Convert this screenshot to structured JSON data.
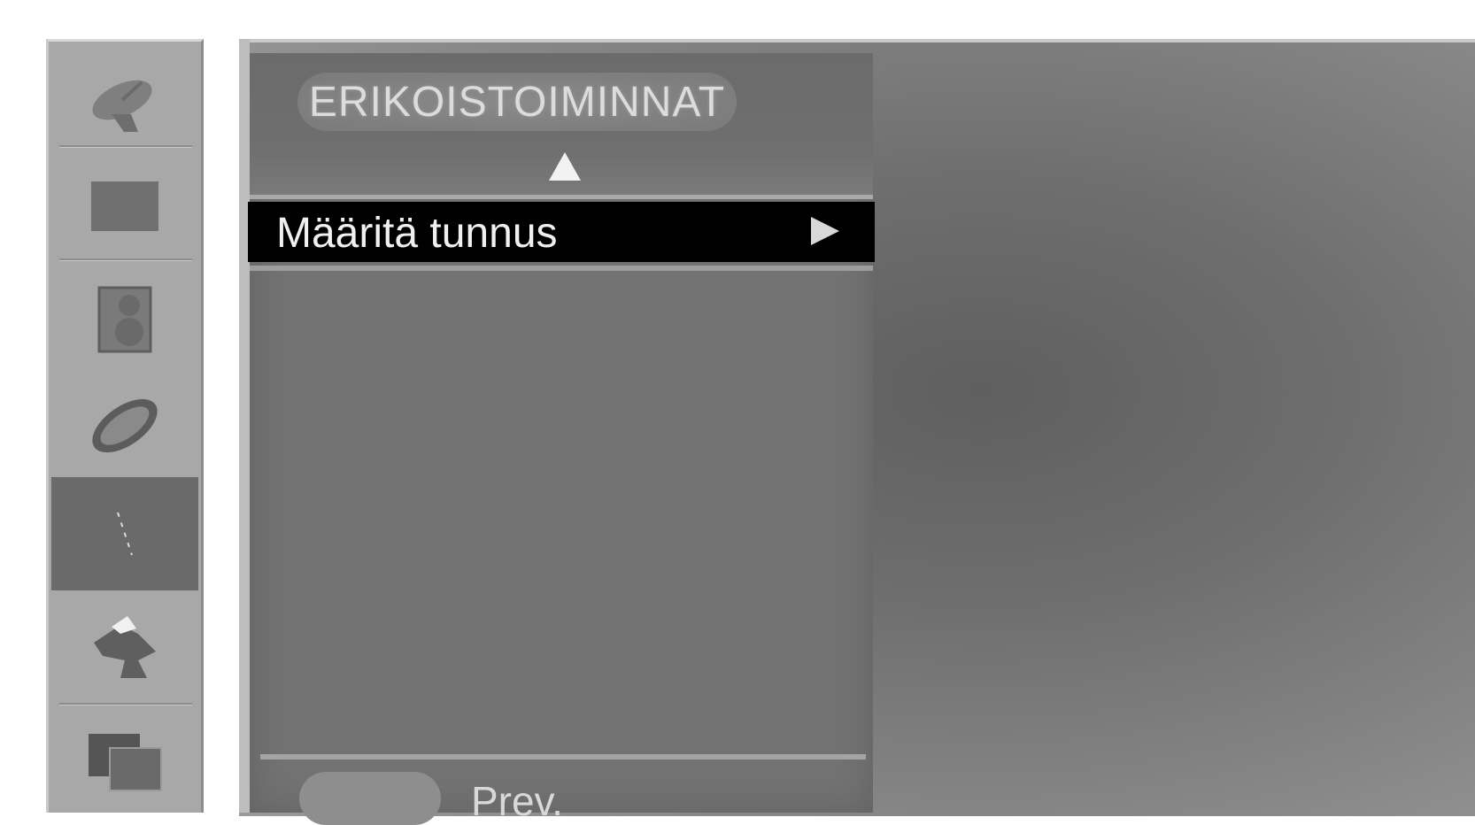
{
  "menu": {
    "title": "ERIKOISTOIMINNAT",
    "selected_item": "Määritä tunnus",
    "footer_label": "Prev."
  },
  "rail": {
    "icons": [
      "satellite-dish-icon",
      "picture-icon",
      "speaker-icon",
      "lens-icon",
      "special-icon",
      "settings-icon",
      "screen-icon"
    ],
    "selected_index": 4
  },
  "colors": {
    "menu_bg": "#727272",
    "selected_row_bg": "#000000",
    "rail_bg": "#a8a8a8"
  }
}
